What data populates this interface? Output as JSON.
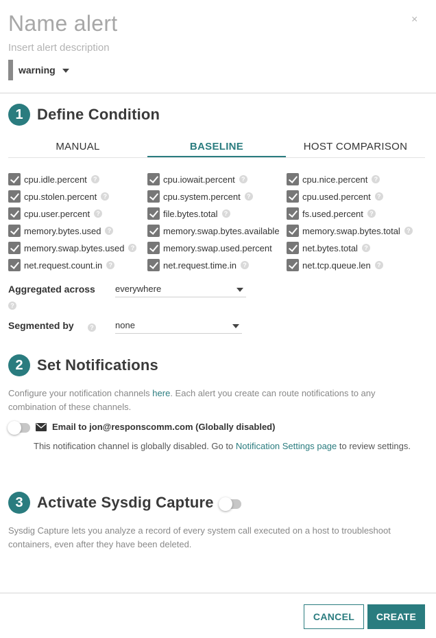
{
  "header": {
    "close_glyph": "×",
    "title": "Name alert",
    "description_placeholder": "Insert alert description",
    "severity": "warning"
  },
  "section1": {
    "number": "1",
    "title": "Define Condition",
    "tabs": [
      "MANUAL",
      "BASELINE",
      "HOST COMPARISON"
    ],
    "active_tab": "BASELINE",
    "metrics": [
      [
        "cpu.idle.percent",
        "cpu.iowait.percent",
        "cpu.nice.percent"
      ],
      [
        "cpu.stolen.percent",
        "cpu.system.percent",
        "cpu.used.percent"
      ],
      [
        "cpu.user.percent",
        "file.bytes.total",
        "fs.used.percent"
      ],
      [
        "memory.bytes.used",
        "memory.swap.bytes.available",
        "memory.swap.bytes.total"
      ],
      [
        "memory.swap.bytes.used",
        "memory.swap.used.percent",
        "net.bytes.total"
      ],
      [
        "net.request.count.in",
        "net.request.time.in",
        "net.tcp.queue.len"
      ]
    ],
    "aggregated_label": "Aggregated across",
    "aggregated_value": "everywhere",
    "segmented_label": "Segmented by",
    "segmented_value": "none"
  },
  "section2": {
    "number": "2",
    "title": "Set Notifications",
    "description_before": "Configure your notification channels ",
    "description_link": "here",
    "description_after": ". Each alert you create can route notifications to any combination of these channels.",
    "channel_label": "Email to jon@responscomm.com (Globally disabled)",
    "channel_note_before": "This notification channel is globally disabled. Go to ",
    "channel_note_link": "Notification Settings page",
    "channel_note_after": " to review settings."
  },
  "section3": {
    "number": "3",
    "title": "Activate Sysdig Capture",
    "description": "Sysdig Capture lets you analyze a record of every system call executed on a host to troubleshoot containers, even after they have been deleted."
  },
  "footer": {
    "cancel_label": "CANCEL",
    "create_label": "CREATE"
  },
  "colors": {
    "accent": "#2a7c7f",
    "checkbox": "#777777",
    "severity_bar": "#8a8a8a"
  }
}
